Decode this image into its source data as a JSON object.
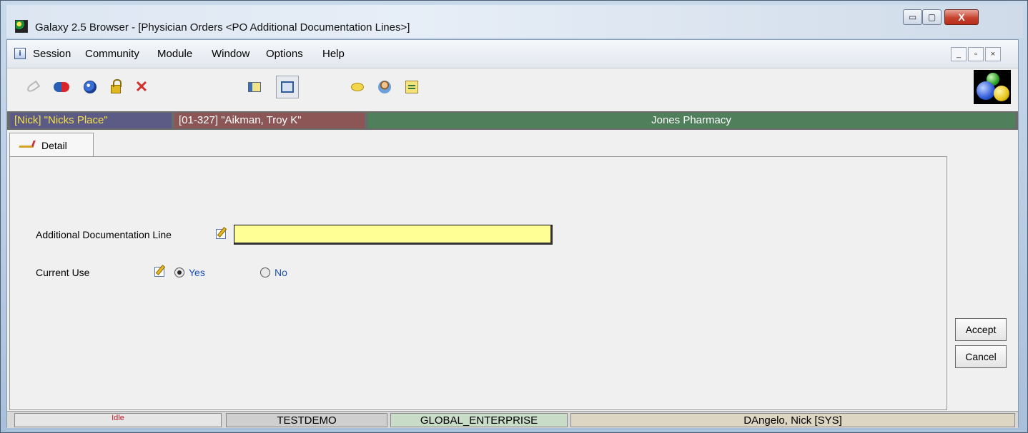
{
  "window": {
    "title": "Galaxy 2.5 Browser - [Physician Orders  <PO Additional Documentation Lines>]",
    "controls": {
      "minimize": "▭",
      "maximize": "▢",
      "close": "X"
    }
  },
  "menu": {
    "items": [
      "Session",
      "Community",
      "Module",
      "Window",
      "Options",
      "Help"
    ],
    "mdi_controls": {
      "minimize": "_",
      "restore": "▫",
      "close": "×"
    }
  },
  "toolbar": {
    "buttons": [
      {
        "icon": "key-icon"
      },
      {
        "icon": "pill-icon"
      },
      {
        "icon": "globe-icon"
      },
      {
        "icon": "lock-icon"
      },
      {
        "icon": "delete-icon"
      },
      {
        "icon": "card-icon"
      },
      {
        "icon": "screen-icon",
        "pressed": true
      },
      {
        "icon": "speech-bubble-icon"
      },
      {
        "icon": "person-icon"
      },
      {
        "icon": "note-icon"
      }
    ]
  },
  "context": {
    "site": "[Nick] \"Nicks Place\"",
    "patient": "[01-327] \"Aikman, Troy K\"",
    "pharmacy": "Jones Pharmacy"
  },
  "tabs": [
    {
      "label": "Detail",
      "active": true
    }
  ],
  "form": {
    "doc_line_label": "Additional Documentation Line",
    "doc_line_value": "",
    "current_use_label": "Current Use",
    "current_use_options": [
      "Yes",
      "No"
    ],
    "current_use_selected": "Yes"
  },
  "actions": {
    "accept": "Accept",
    "cancel": "Cancel"
  },
  "status": {
    "state": "Idle",
    "database": "TESTDEMO",
    "enterprise": "GLOBAL_ENTERPRISE",
    "user": "DAngelo, Nick [SYS]"
  },
  "colors": {
    "site_bg": "#5b5b86",
    "site_text": "#f4e04b",
    "patient_bg": "#8d5656",
    "pharmacy_bg": "#4f7f5b",
    "input_bg": "#ffff96",
    "radio_label": "#1a4fb8"
  }
}
